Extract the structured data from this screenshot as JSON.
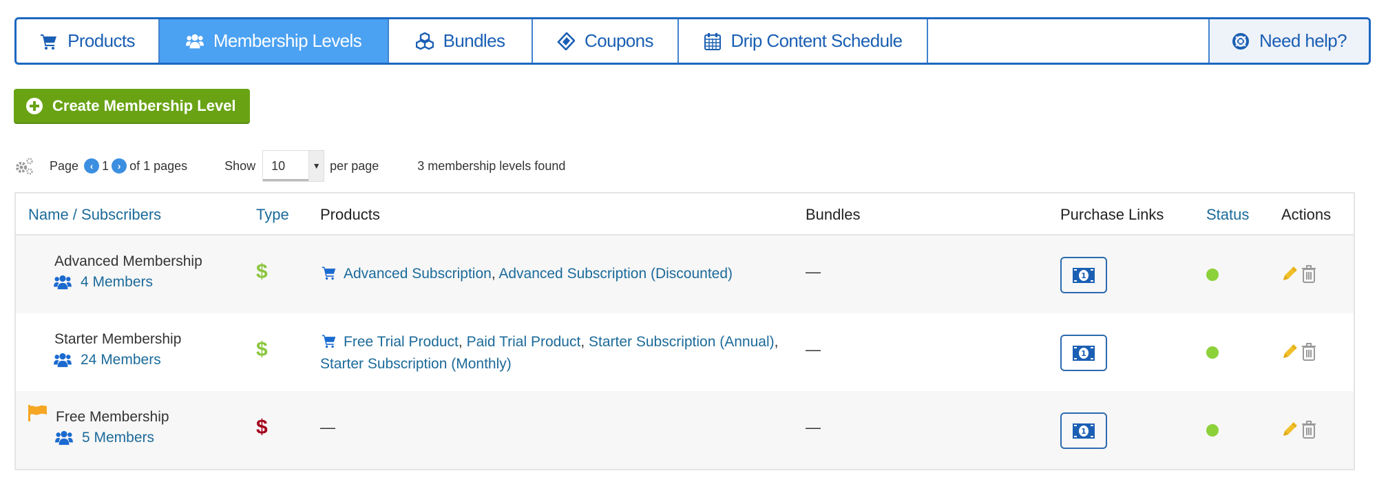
{
  "tabs": [
    {
      "label": "Products",
      "icon": "cart-icon",
      "active": false
    },
    {
      "label": "Membership Levels",
      "icon": "users-icon",
      "active": true
    },
    {
      "label": "Bundles",
      "icon": "cubes-icon",
      "active": false
    },
    {
      "label": "Coupons",
      "icon": "ticket-icon",
      "active": false
    },
    {
      "label": "Drip Content Schedule",
      "icon": "calendar-icon",
      "active": false
    },
    {
      "label": "Need help?",
      "icon": "life-ring-icon",
      "active": false
    }
  ],
  "create_button": {
    "label": "Create Membership Level",
    "icon": "plus-circle-icon"
  },
  "pager": {
    "page_label": "Page",
    "current_page": "1",
    "of_label": "of 1 pages",
    "show_label": "Show",
    "per_page_value": "10",
    "per_page_label": "per page",
    "found_text": "3 membership levels found",
    "settings_icon": "gears-icon"
  },
  "table": {
    "headers": {
      "name": "Name / Subscribers",
      "type": "Type",
      "products": "Products",
      "bundles": "Bundles",
      "purchase_links": "Purchase Links",
      "status": "Status",
      "actions": "Actions"
    },
    "rows": [
      {
        "name": "Advanced Membership",
        "members": "4 Members",
        "type_symbol": "$",
        "type": "paid",
        "products": [
          "Advanced Subscription",
          "Advanced Subscription (Discounted)"
        ],
        "bundles": "—",
        "status": "active",
        "default_flag": false
      },
      {
        "name": "Starter Membership",
        "members": "24 Members",
        "type_symbol": "$",
        "type": "paid",
        "products": [
          "Free Trial Product",
          "Paid Trial Product",
          "Starter Subscription (Annual)",
          "Starter Subscription (Monthly)"
        ],
        "bundles": "—",
        "status": "active",
        "default_flag": false
      },
      {
        "name": "Free Membership",
        "members": "5 Members",
        "type_symbol": "$",
        "type": "free",
        "products_empty": "—",
        "bundles": "—",
        "status": "active",
        "default_flag": true
      }
    ]
  },
  "colors": {
    "tab_border": "#1c68c0",
    "tab_active_bg": "#4ba1f2",
    "tab_text": "#1a5fb4",
    "create_button_bg": "#69a314",
    "link": "#1b6a9a",
    "paid_type": "#8cc63f",
    "free_type": "#a3001b",
    "status_active": "#8cd13a",
    "edit_icon": "#f0c02a",
    "delete_icon": "#999999"
  }
}
